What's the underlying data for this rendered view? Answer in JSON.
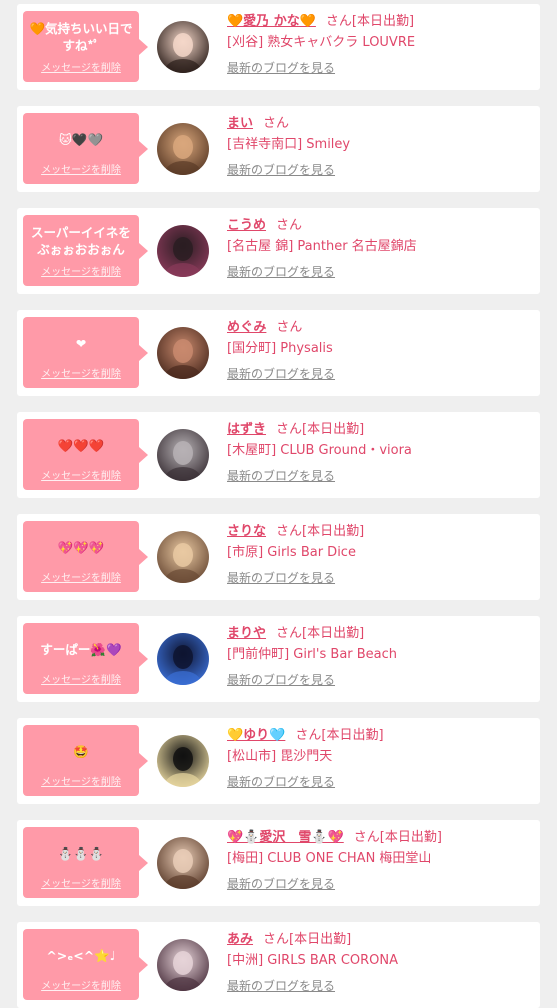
{
  "delete_label": "メッセージを削除",
  "blog_label": "最新のブログを見る",
  "san_label": "さん",
  "colors": {
    "accent": "#e0476a",
    "bubble": "#ff9aa8",
    "page_bg": "#efefef"
  },
  "items": [
    {
      "message": "🧡気持ちいい日で\nすね*ﾟ",
      "name": "🧡愛乃 かな🧡",
      "status": "[本日出勤]",
      "shop": "[刈谷] 熟女キャバクラ LOUVRE",
      "avatar": [
        "#f4d7c9",
        "#2b1e1a"
      ]
    },
    {
      "message": "🐱🖤🩶",
      "name": "まい",
      "status": "",
      "shop": "[吉祥寺南口] Smiley",
      "avatar": [
        "#d9a77c",
        "#5a3a26"
      ]
    },
    {
      "message": "スーパーイイネを\nぶぉぉおおぉん",
      "name": "こうめ",
      "status": "",
      "shop": "[名古屋 錦] Panther 名古屋錦店",
      "avatar": [
        "#2a1d22",
        "#8a3a5a"
      ]
    },
    {
      "message": "❤",
      "name": "めぐみ",
      "status": "",
      "shop": "[国分町] Physalis",
      "avatar": [
        "#c98a6e",
        "#4a2a1e"
      ]
    },
    {
      "message": "❤️❤️❤️",
      "name": "はずき",
      "status": "[本日出勤]",
      "shop": "[木屋町] CLUB Ground・viora",
      "avatar": [
        "#b7b2b5",
        "#3a3036"
      ]
    },
    {
      "message": "💖💖💖",
      "name": "さりな",
      "status": "[本日出勤]",
      "shop": "[市原] Girls Bar Dice",
      "avatar": [
        "#e9c9a2",
        "#6a4a35"
      ]
    },
    {
      "message": "すーぱー🌺💜",
      "name": "まりや",
      "status": "[本日出勤]",
      "shop": "[門前仲町] Girl's Bar Beach",
      "avatar": [
        "#0e1430",
        "#3b6fd6"
      ]
    },
    {
      "message": "🤩",
      "name": "💛ゆり🩵",
      "status": "[本日出勤]",
      "shop": "[松山市] 毘沙門天",
      "avatar": [
        "#111111",
        "#e8d7a0"
      ]
    },
    {
      "message": "⛄⛄⛄",
      "name": "💖⛄愛沢　雪⛄💖",
      "status": "[本日出勤]",
      "shop": "[梅田] CLUB ONE CHAN 梅田堂山",
      "avatar": [
        "#e9cdb7",
        "#5b3c2b"
      ]
    },
    {
      "message": "^>ₑ<^⭐♩",
      "name": "あみ",
      "status": "[本日出勤]",
      "shop": "[中洲] GIRLS BAR CORONA",
      "avatar": [
        "#e6d3d8",
        "#4d3340"
      ]
    }
  ]
}
